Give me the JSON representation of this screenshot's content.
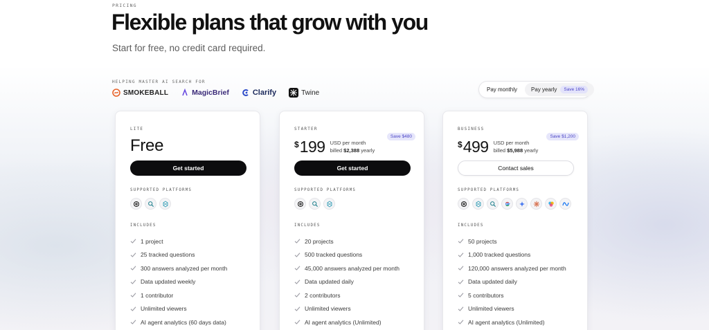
{
  "hero": {
    "eyebrow": "PRICING",
    "title": "Flexible plans that grow with you",
    "subtitle": "Start for free, no credit card required."
  },
  "logos": {
    "label": "HELPING MASTER AI SEARCH FOR",
    "items": [
      "SMOKEBALL",
      "MagicBrief",
      "Clarify",
      "Twine"
    ]
  },
  "billing": {
    "monthly": "Pay monthly",
    "yearly": "Pay yearly",
    "save": "Save 16%",
    "selected": "Pay yearly"
  },
  "labels": {
    "platforms": "SUPPORTED PLATFORMS",
    "includes": "INCLUDES"
  },
  "plans": {
    "lite": {
      "name": "LITE",
      "price": "Free",
      "cta": "Get started",
      "platform_icons": [
        "chatgpt-icon",
        "perplexity-icon",
        "deepseek-icon"
      ],
      "features": [
        "1 project",
        "25 tracked questions",
        "300 answers analyzed per month",
        "Data updated weekly",
        "1 contributor",
        "Unlimited viewers",
        "AI agent analytics (60 days data)"
      ]
    },
    "starter": {
      "name": "STARTER",
      "currency": "$",
      "amount": "199",
      "per": "USD per month",
      "billed_prefix": "billed ",
      "billed_amount": "$2,388",
      "billed_suffix": " yearly",
      "save": "Save $480",
      "cta": "Get started",
      "platform_icons": [
        "chatgpt-icon",
        "perplexity-icon",
        "deepseek-icon"
      ],
      "features": [
        "20 projects",
        "500 tracked questions",
        "45,000 answers analyzed per month",
        "Data updated daily",
        "2 contributors",
        "Unlimited viewers",
        "AI agent analytics (Unlimited)"
      ]
    },
    "business": {
      "name": "BUSINESS",
      "currency": "$",
      "amount": "499",
      "per": "USD per month",
      "billed_prefix": "billed ",
      "billed_amount": "$5,988",
      "billed_suffix": " yearly",
      "save": "Save $1,200",
      "cta": "Contact sales",
      "platform_icons": [
        "chatgpt-icon",
        "deepseek-icon",
        "perplexity-icon",
        "google-icon",
        "gemini-icon",
        "claude-icon",
        "copilot-icon",
        "meta-icon"
      ],
      "features": [
        "50 projects",
        "1,000 tracked questions",
        "120,000 answers analyzed per month",
        "Data updated daily",
        "5 contributors",
        "Unlimited viewers",
        "AI agent analytics (Unlimited)"
      ]
    }
  },
  "colors": {
    "accent": "#4a44c6",
    "accent_bg": "#e6e6fb",
    "button_dark": "#0c0c0e",
    "text": "#141414"
  }
}
